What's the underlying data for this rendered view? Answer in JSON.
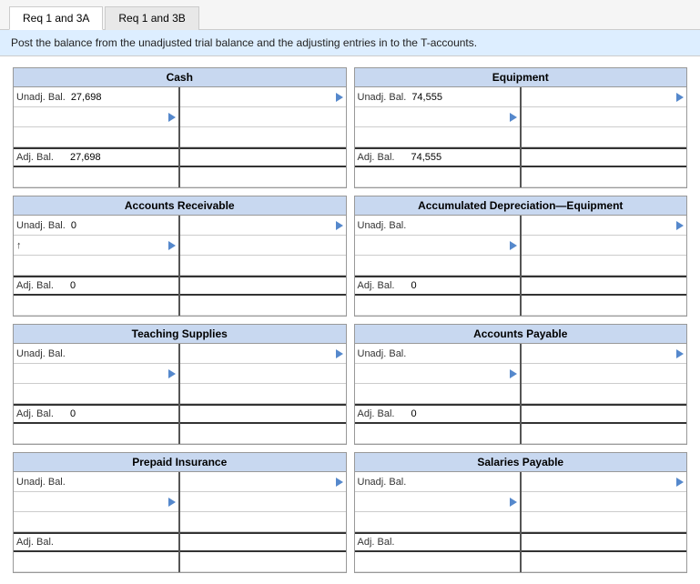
{
  "tabs": [
    {
      "id": "req1-3a",
      "label": "Req 1 and 3A",
      "active": true
    },
    {
      "id": "req1-3b",
      "label": "Req 1 and 3B",
      "active": false
    }
  ],
  "instruction": "Post the balance from the unadjusted trial balance and the adjusting entries in to the T-accounts.",
  "accounts": [
    {
      "id": "cash",
      "title": "Cash",
      "left": {
        "rows": [
          {
            "label": "Unadj. Bal.",
            "value": "27,698",
            "hasArrow": false
          },
          {
            "label": "",
            "value": "",
            "hasArrow": true
          },
          {
            "label": "",
            "value": "",
            "hasArrow": false
          }
        ],
        "balance_label": "Adj. Bal.",
        "balance_value": "27,698"
      },
      "right": {
        "rows": [
          {
            "label": "",
            "value": "",
            "hasArrow": true
          },
          {
            "label": "",
            "value": "",
            "hasArrow": false
          },
          {
            "label": "",
            "value": "",
            "hasArrow": false
          }
        ],
        "balance_label": "",
        "balance_value": ""
      }
    },
    {
      "id": "equipment",
      "title": "Equipment",
      "left": {
        "rows": [
          {
            "label": "Unadj. Bal.",
            "value": "74,555",
            "hasArrow": false
          },
          {
            "label": "",
            "value": "",
            "hasArrow": true
          },
          {
            "label": "",
            "value": "",
            "hasArrow": false
          }
        ],
        "balance_label": "Adj. Bal.",
        "balance_value": "74,555"
      },
      "right": {
        "rows": [
          {
            "label": "",
            "value": "",
            "hasArrow": true
          },
          {
            "label": "",
            "value": "",
            "hasArrow": false
          },
          {
            "label": "",
            "value": "",
            "hasArrow": false
          }
        ],
        "balance_label": "",
        "balance_value": ""
      }
    },
    {
      "id": "accounts-receivable",
      "title": "Accounts Receivable",
      "left": {
        "rows": [
          {
            "label": "Unadj. Bal.",
            "value": "0",
            "hasArrow": false
          },
          {
            "label": "↑",
            "value": "",
            "hasArrow": false
          },
          {
            "label": "",
            "value": "",
            "hasArrow": false
          }
        ],
        "balance_label": "Adj. Bal.",
        "balance_value": "0"
      },
      "right": {
        "rows": [
          {
            "label": "",
            "value": "",
            "hasArrow": true
          },
          {
            "label": "",
            "value": "",
            "hasArrow": false
          },
          {
            "label": "",
            "value": "",
            "hasArrow": false
          }
        ],
        "balance_label": "",
        "balance_value": ""
      }
    },
    {
      "id": "accumulated-depreciation-equipment",
      "title": "Accumulated Depreciation—Equipment",
      "left": {
        "rows": [
          {
            "label": "Unadj. Bal.",
            "value": "",
            "hasArrow": false
          },
          {
            "label": "",
            "value": "",
            "hasArrow": false
          },
          {
            "label": "",
            "value": "",
            "hasArrow": false
          }
        ],
        "balance_label": "Adj. Bal.",
        "balance_value": "0"
      },
      "right": {
        "rows": [
          {
            "label": "",
            "value": "",
            "hasArrow": true
          },
          {
            "label": "",
            "value": "",
            "hasArrow": false
          },
          {
            "label": "",
            "value": "",
            "hasArrow": false
          }
        ],
        "balance_label": "",
        "balance_value": ""
      }
    },
    {
      "id": "teaching-supplies",
      "title": "Teaching Supplies",
      "left": {
        "rows": [
          {
            "label": "Unadj. Bal.",
            "value": "",
            "hasArrow": false
          },
          {
            "label": "",
            "value": "",
            "hasArrow": false
          },
          {
            "label": "",
            "value": "",
            "hasArrow": false
          }
        ],
        "balance_label": "Adj. Bal.",
        "balance_value": "0"
      },
      "right": {
        "rows": [
          {
            "label": "",
            "value": "",
            "hasArrow": true
          },
          {
            "label": "",
            "value": "",
            "hasArrow": false
          },
          {
            "label": "",
            "value": "",
            "hasArrow": false
          }
        ],
        "balance_label": "",
        "balance_value": ""
      }
    },
    {
      "id": "accounts-payable",
      "title": "Accounts Payable",
      "left": {
        "rows": [
          {
            "label": "Unadj. Bal.",
            "value": "",
            "hasArrow": false
          },
          {
            "label": "",
            "value": "",
            "hasArrow": false
          },
          {
            "label": "",
            "value": "",
            "hasArrow": false
          }
        ],
        "balance_label": "Adj. Bal.",
        "balance_value": "0"
      },
      "right": {
        "rows": [
          {
            "label": "",
            "value": "",
            "hasArrow": true
          },
          {
            "label": "",
            "value": "",
            "hasArrow": false
          },
          {
            "label": "",
            "value": "",
            "hasArrow": false
          }
        ],
        "balance_label": "",
        "balance_value": ""
      }
    },
    {
      "id": "prepaid-insurance",
      "title": "Prepaid Insurance",
      "left": {
        "rows": [
          {
            "label": "Unadj. Bal.",
            "value": "",
            "hasArrow": false
          },
          {
            "label": "",
            "value": "",
            "hasArrow": false
          },
          {
            "label": "",
            "value": "",
            "hasArrow": false
          }
        ],
        "balance_label": "Adj. Bal.",
        "balance_value": ""
      },
      "right": {
        "rows": [
          {
            "label": "",
            "value": "",
            "hasArrow": true
          },
          {
            "label": "",
            "value": "",
            "hasArrow": false
          },
          {
            "label": "",
            "value": "",
            "hasArrow": false
          }
        ],
        "balance_label": "",
        "balance_value": ""
      }
    },
    {
      "id": "salaries-payable",
      "title": "Salaries Payable",
      "left": {
        "rows": [
          {
            "label": "Unadj. Bal.",
            "value": "",
            "hasArrow": false
          },
          {
            "label": "",
            "value": "",
            "hasArrow": false
          },
          {
            "label": "",
            "value": "",
            "hasArrow": false
          }
        ],
        "balance_label": "Adj. Bal.",
        "balance_value": ""
      },
      "right": {
        "rows": [
          {
            "label": "",
            "value": "",
            "hasArrow": true
          },
          {
            "label": "",
            "value": "",
            "hasArrow": false
          },
          {
            "label": "",
            "value": "",
            "hasArrow": false
          }
        ],
        "balance_label": "",
        "balance_value": ""
      }
    }
  ]
}
